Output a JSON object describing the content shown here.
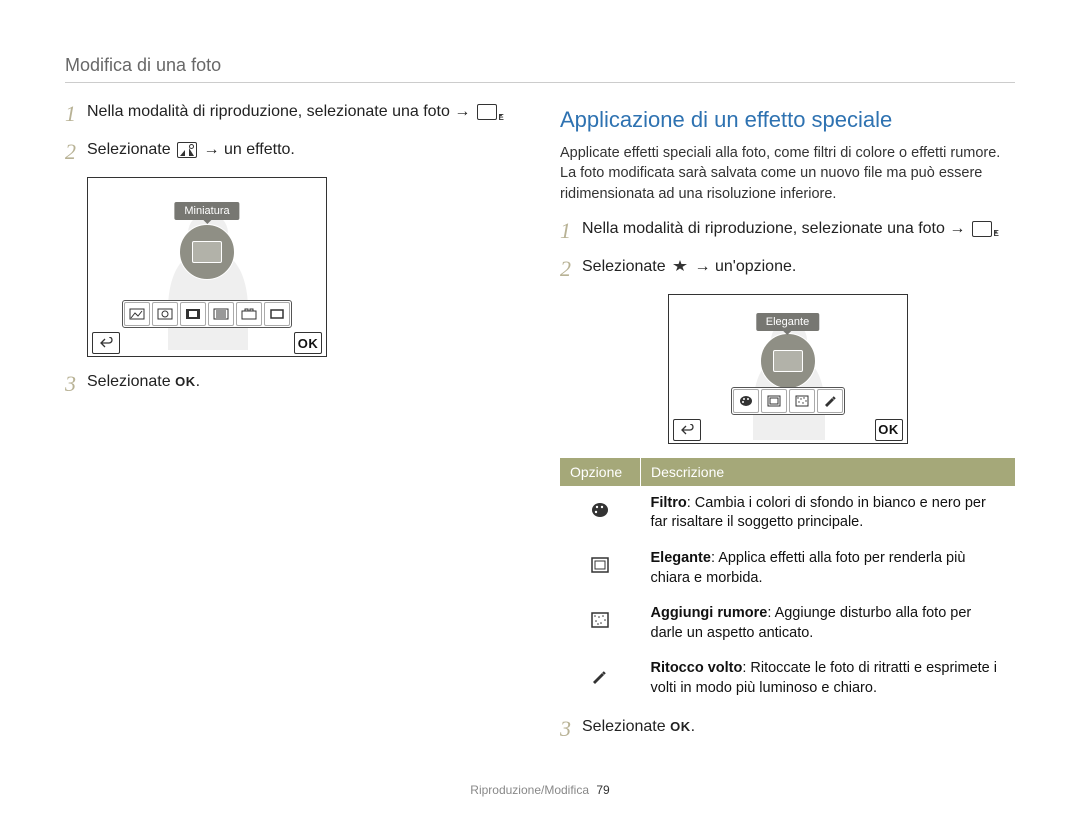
{
  "page_title": "Modifica di una foto",
  "left": {
    "steps": [
      {
        "num": "1",
        "text_before": "Nella modalità di riproduzione, selezionate una foto →",
        "icon_after": "edit-E",
        "text_after": "."
      },
      {
        "num": "2",
        "text_before": "Selezionate",
        "icon_mid": "landscape",
        "text_after": "→ un effetto."
      },
      {
        "num": "3",
        "text_before": "Selezionate",
        "ok_after": "OK",
        "text_after": "."
      }
    ],
    "preview_tooltip": "Miniatura",
    "preview_ok": "OK"
  },
  "right": {
    "heading": "Applicazione di un effetto speciale",
    "paragraph": "Applicate effetti speciali alla foto, come filtri di colore o effetti rumore. La foto modificata sarà salvata come un nuovo file ma può essere ridimensionata ad una risoluzione inferiore.",
    "steps": [
      {
        "num": "1",
        "text_before": "Nella modalità di riproduzione, selezionate una foto →",
        "icon_after": "edit-E",
        "text_after": "."
      },
      {
        "num": "2",
        "text_before": "Selezionate",
        "icon_mid": "star",
        "text_after": "→ un'opzione."
      },
      {
        "num": "3",
        "text_before": "Selezionate",
        "ok_after": "OK",
        "text_after": "."
      }
    ],
    "preview_tooltip": "Elegante",
    "preview_ok": "OK",
    "table": {
      "headers": [
        "Opzione",
        "Descrizione"
      ],
      "rows": [
        {
          "icon": "palette",
          "bold": "Filtro",
          "rest": ": Cambia i colori di sfondo in bianco e nero per far risaltare il soggetto principale."
        },
        {
          "icon": "frame",
          "bold": "Elegante",
          "rest": ": Applica effetti alla foto per renderla più chiara e morbida."
        },
        {
          "icon": "noise",
          "bold": "Aggiungi rumore",
          "rest": ": Aggiunge disturbo alla foto per darle un aspetto anticato."
        },
        {
          "icon": "brush",
          "bold": "Ritocco volto",
          "rest": ": Ritoccate le foto di ritratti e esprimete i volti in modo più luminoso e chiaro."
        }
      ]
    }
  },
  "footer": {
    "section": "Riproduzione/Modifica",
    "page": "79"
  }
}
